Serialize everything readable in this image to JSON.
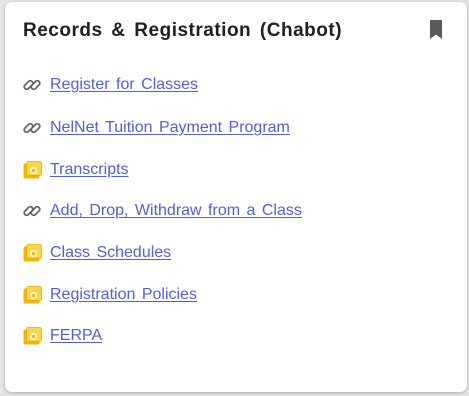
{
  "card": {
    "title": "Records & Registration (Chabot)",
    "bookmark_icon": "bookmark-icon"
  },
  "links": [
    {
      "label": "Register for Classes",
      "icon": "link-icon"
    },
    {
      "label": "NelNet Tuition Payment Program",
      "icon": "link-icon"
    },
    {
      "label": "Transcripts",
      "icon": "page-icon"
    },
    {
      "label": "Add, Drop, Withdraw from a Class",
      "icon": "link-icon"
    },
    {
      "label": "Class Schedules",
      "icon": "page-icon"
    },
    {
      "label": "Registration Policies",
      "icon": "page-icon"
    },
    {
      "label": "FERPA",
      "icon": "page-icon"
    }
  ],
  "colors": {
    "link": "#5560c8",
    "title": "#202020",
    "icon_gray": "#666666",
    "page_icon_gold": "#f2b705"
  }
}
